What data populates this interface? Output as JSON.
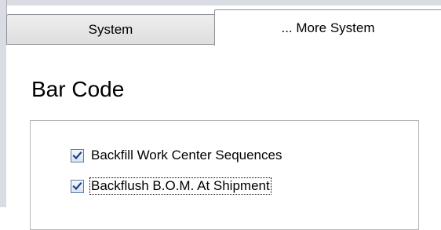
{
  "tabs": [
    {
      "label": "System",
      "selected": false
    },
    {
      "label": "... More System",
      "selected": true
    }
  ],
  "section": {
    "title": "Bar Code"
  },
  "options": [
    {
      "label": "Backfill Work Center Sequences",
      "checked": true
    },
    {
      "label": "Backflush B.O.M. At Shipment",
      "checked": true,
      "focused": true
    }
  ],
  "colors": {
    "checkmark": "#1f3f8f",
    "tab_border": "#8c8f95"
  },
  "icons": {
    "checkmark": "checkmark-icon"
  }
}
